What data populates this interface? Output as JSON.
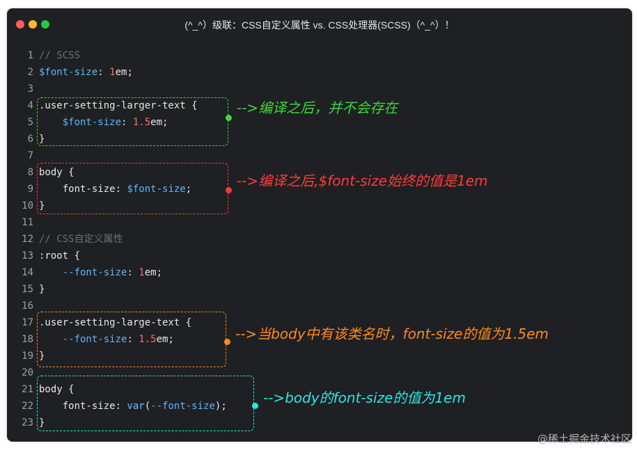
{
  "window": {
    "title": "(^_^）级联：CSS自定义属性 vs. CSS处理器(SCSS)（^_^）！"
  },
  "code_lines": [
    {
      "n": "1",
      "t": "// SCSS"
    },
    {
      "n": "2",
      "t": "$font-size: 1em;"
    },
    {
      "n": "3",
      "t": ""
    },
    {
      "n": "4",
      "t": ".user-setting-larger-text {"
    },
    {
      "n": "5",
      "t": "    $font-size: 1.5em;"
    },
    {
      "n": "6",
      "t": "}"
    },
    {
      "n": "7",
      "t": ""
    },
    {
      "n": "8",
      "t": "body {"
    },
    {
      "n": "9",
      "t": "    font-size: $font-size;"
    },
    {
      "n": "10",
      "t": "}"
    },
    {
      "n": "11",
      "t": ""
    },
    {
      "n": "12",
      "t": "// CSS自定义属性"
    },
    {
      "n": "13",
      "t": ":root {"
    },
    {
      "n": "14",
      "t": "    --font-size: 1em;"
    },
    {
      "n": "15",
      "t": "}"
    },
    {
      "n": "16",
      "t": ""
    },
    {
      "n": "17",
      "t": ".user-setting-large-text {"
    },
    {
      "n": "18",
      "t": "    --font-size: 1.5em;"
    },
    {
      "n": "19",
      "t": "}"
    },
    {
      "n": "20",
      "t": ""
    },
    {
      "n": "21",
      "t": "body {"
    },
    {
      "n": "22",
      "t": "    font-size: var(--font-size);"
    },
    {
      "n": "23",
      "t": "}"
    }
  ],
  "annotations": [
    {
      "text": "-->编译之后，并不会存在",
      "color": "#3ed63e"
    },
    {
      "text": "-->编译之后,$font-size始终的值是1em",
      "color": "#ff3b3b"
    },
    {
      "text": "-->当body中有该类名时，font-size的值为1.5em",
      "color": "#ff8a1f"
    },
    {
      "text": "-->body的font-size的值为1em",
      "color": "#2ee6e6"
    }
  ],
  "watermark": "@稀土掘金技术社区"
}
